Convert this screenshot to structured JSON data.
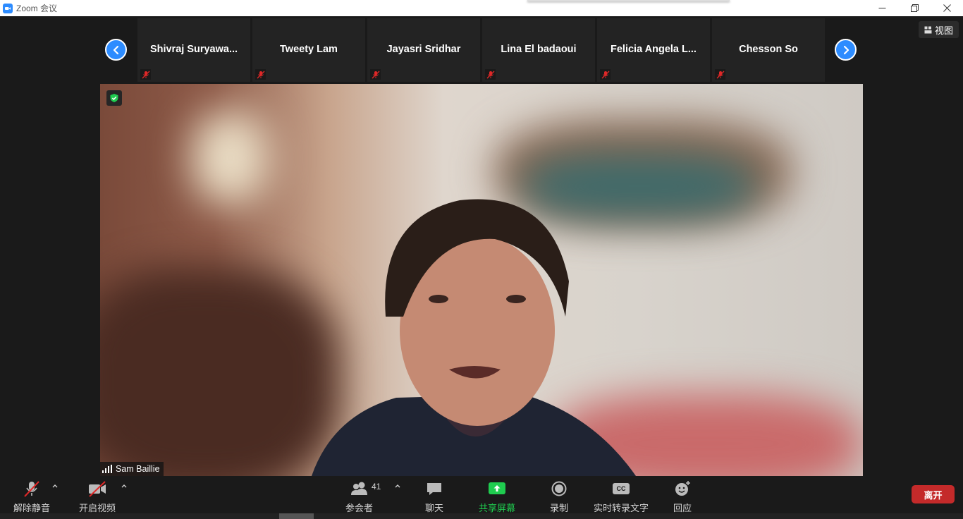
{
  "window": {
    "title": "Zoom 会议"
  },
  "view_button": {
    "label": "视图"
  },
  "participants_strip": [
    {
      "name": "Shivraj  Suryawa..."
    },
    {
      "name": "Tweety Lam"
    },
    {
      "name": "Jayasri Sridhar"
    },
    {
      "name": "Lina El badaoui"
    },
    {
      "name": "Felicia  Angela  L..."
    },
    {
      "name": "Chesson So"
    }
  ],
  "main_video": {
    "speaker_name": "Sam Baillie"
  },
  "toolbar": {
    "unmute_label": "解除静音",
    "start_video_label": "开启视频",
    "participants_label": "参会者",
    "participants_count": "41",
    "chat_label": "聊天",
    "share_label": "共享屏幕",
    "record_label": "录制",
    "captions_label": "实时转录文字",
    "captions_icon_text": "CC",
    "reactions_label": "回应",
    "leave_label": "离开"
  },
  "colors": {
    "accent": "#2d8cff",
    "share_green": "#1fcc4f",
    "leave_red": "#c42a2a",
    "muted_red": "#e02828"
  },
  "icons": {
    "strip_prev": "chevron-left-icon",
    "strip_next": "chevron-right-icon",
    "encryption": "shield-check-icon"
  }
}
